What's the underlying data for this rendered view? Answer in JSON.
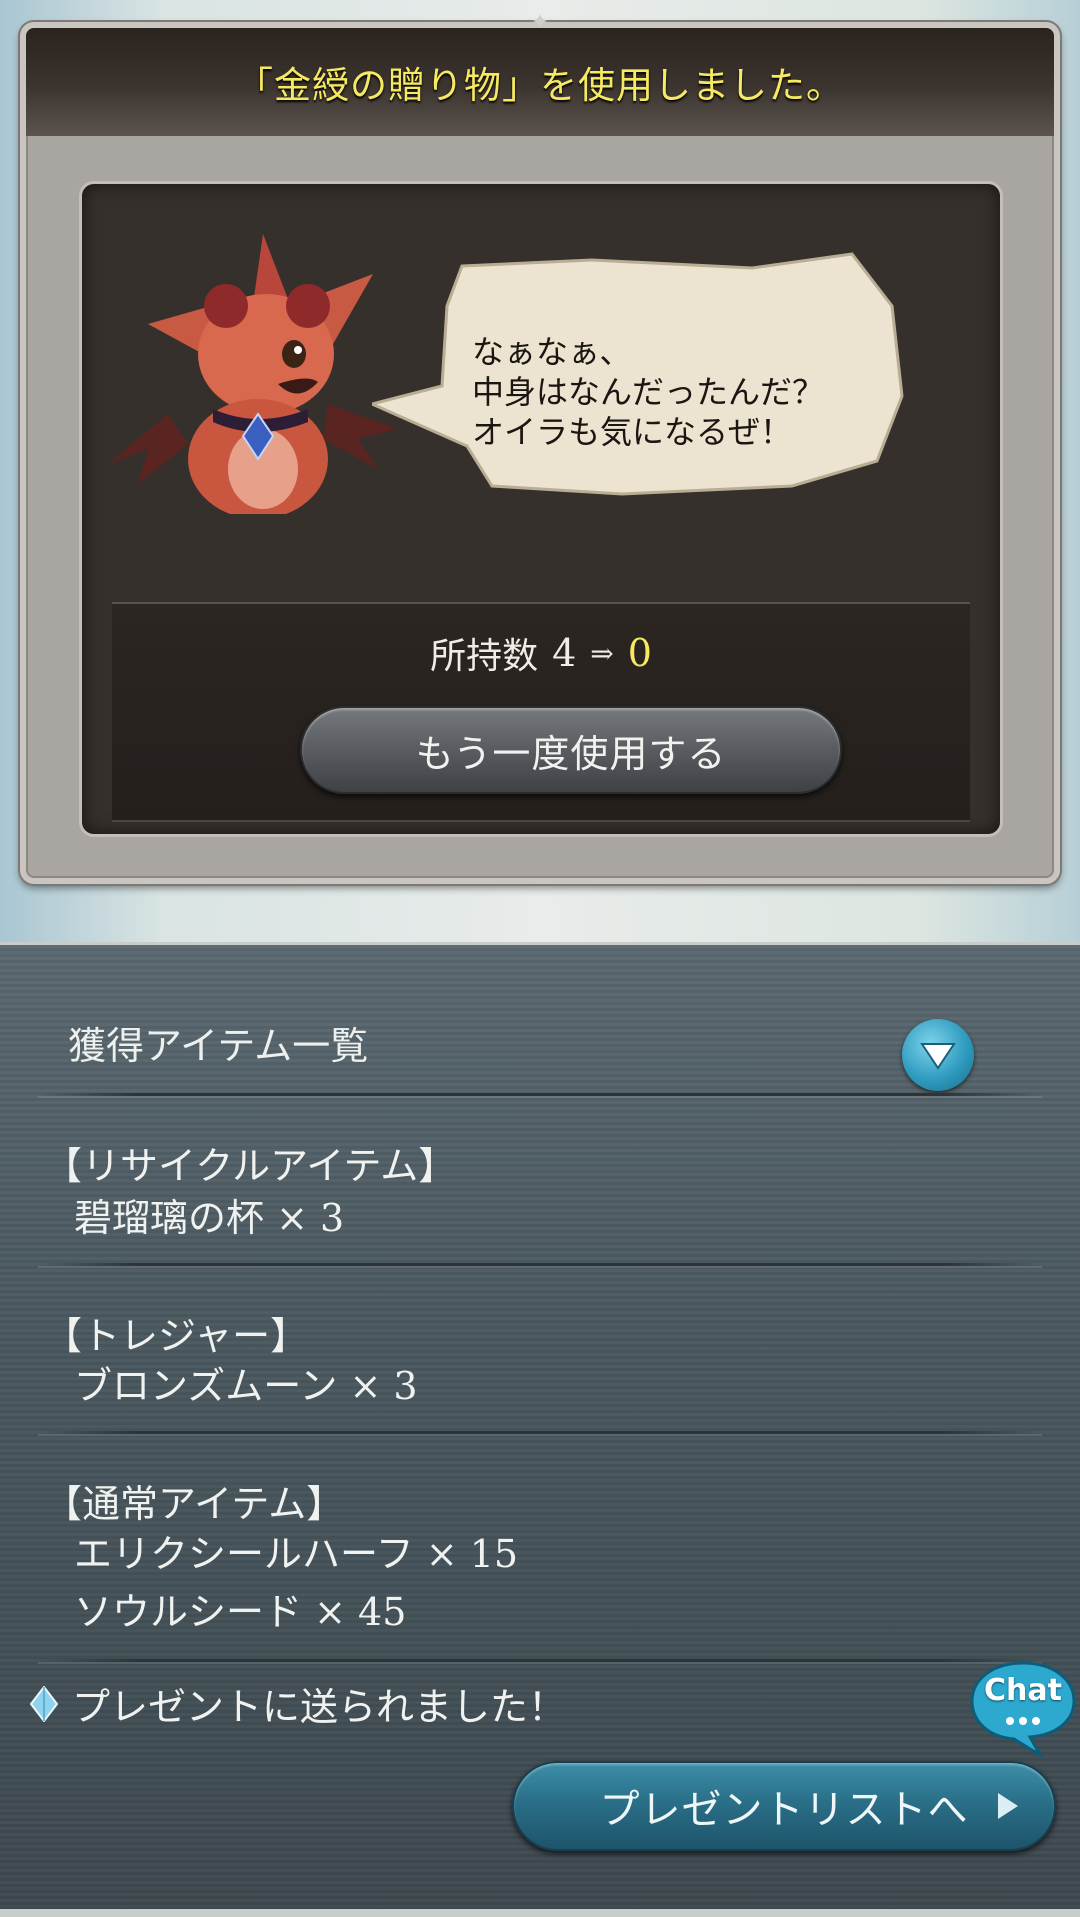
{
  "dialog": {
    "title": "「金綬の贈り物」を使用しました。",
    "speech": "なぁなぁ、\n中身はなんだったんだ？\nオイラも気になるぜ！",
    "count_label": "所持数",
    "count_before": "4",
    "count_arrow": "⇒",
    "count_after": "0",
    "reuse_button": "もう一度使用する"
  },
  "loot": {
    "header": "獲得アイテム一覧",
    "categories": [
      {
        "title": "【リサイクルアイテム】",
        "items": [
          {
            "name": "碧瑠璃の杯",
            "qty": "× 3"
          }
        ]
      },
      {
        "title": "【トレジャー】",
        "items": [
          {
            "name": "ブロンズムーン",
            "qty": "× 3"
          }
        ]
      },
      {
        "title": "【通常アイテム】",
        "items": [
          {
            "name": "エリクシールハーフ",
            "qty": "× 15"
          },
          {
            "name": "ソウルシード",
            "qty": "× 45"
          }
        ]
      }
    ],
    "sent_message": "プレゼントに送られました！",
    "present_button": "プレゼントリストへ",
    "chat_label": "Chat"
  },
  "colors": {
    "title_yellow": "#f7ea63",
    "accent_blue": "#2f9cc0",
    "panel_dark": "#36302c"
  }
}
